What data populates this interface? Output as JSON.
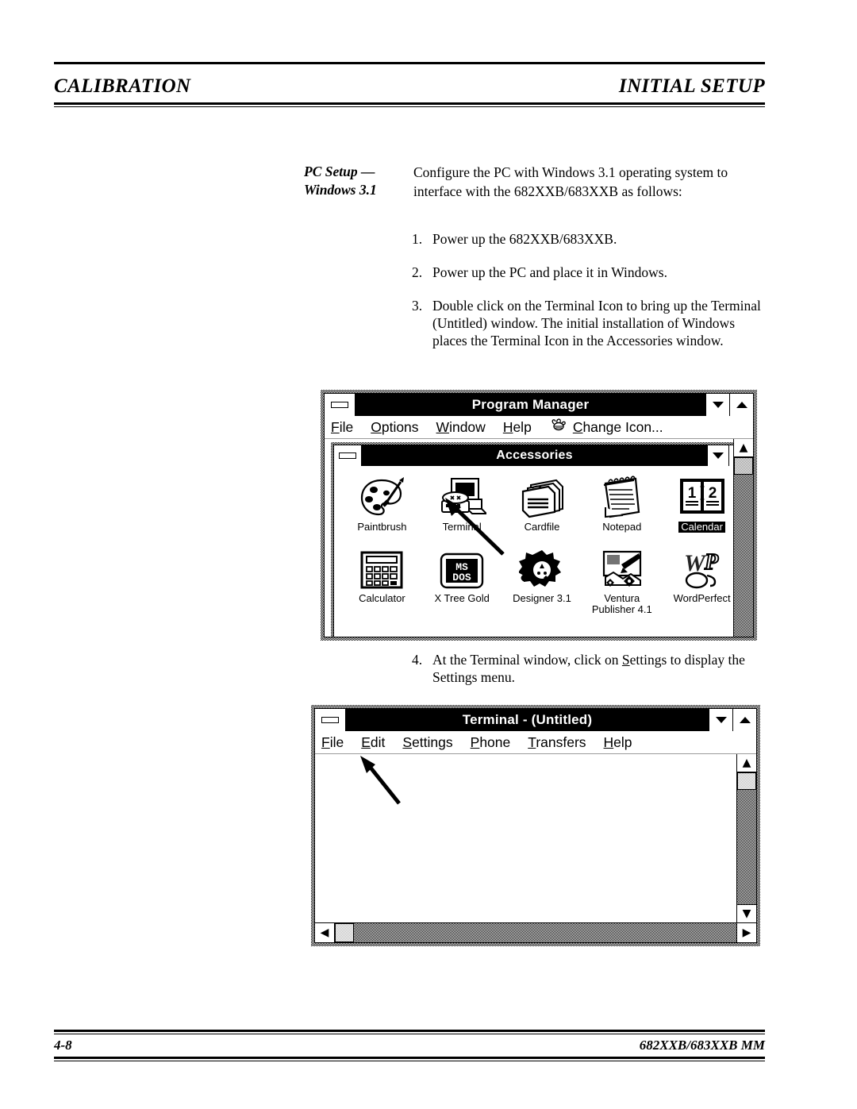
{
  "header": {
    "left": "CALIBRATION",
    "right": "INITIAL SETUP"
  },
  "side_heading": {
    "line1": "PC Setup —",
    "line2": "Windows 3.1"
  },
  "intro": "Configure the PC with Windows 3.1 operating system to interface with the 682XXB/683XXB as follows:",
  "steps": [
    {
      "num": "1.",
      "text": "Power up the 682XXB/683XXB."
    },
    {
      "num": "2.",
      "text": "Power up the PC and place it in Windows."
    },
    {
      "num": "3.",
      "text": "Double click on the Terminal Icon to bring up the Terminal (Untitled) window. The initial installation of Windows places the Terminal Icon in the Accessories window."
    }
  ],
  "step4": {
    "num": "4.",
    "text_before": "At the Terminal window, click on ",
    "accel": "S",
    "text_after": "ettings to display the Settings menu."
  },
  "progman": {
    "title": "Program Manager",
    "menu": [
      {
        "accel": "F",
        "rest": "ile"
      },
      {
        "accel": "O",
        "rest": "ptions"
      },
      {
        "accel": "W",
        "rest": "indow"
      },
      {
        "accel": "H",
        "rest": "elp"
      }
    ],
    "change_icon": {
      "accel": "C",
      "rest": "hange Icon..."
    },
    "minimize_label": "minimize",
    "maximize_label": "maximize",
    "group": {
      "title": "Accessories",
      "rows": [
        [
          {
            "label": "Paintbrush",
            "icon": "paintbrush-icon",
            "selected": false
          },
          {
            "label": "Terminal",
            "icon": "terminal-icon",
            "selected": false
          },
          {
            "label": "Cardfile",
            "icon": "cardfile-icon",
            "selected": false
          },
          {
            "label": "Notepad",
            "icon": "notepad-icon",
            "selected": false
          },
          {
            "label": "Calendar",
            "icon": "calendar-icon",
            "selected": true
          }
        ],
        [
          {
            "label": "Calculator",
            "icon": "calculator-icon",
            "selected": false
          },
          {
            "label": "X Tree Gold",
            "icon": "msdos-icon",
            "selected": false
          },
          {
            "label": "Designer 3.1",
            "icon": "designer-icon",
            "selected": false
          },
          {
            "label": "Ventura",
            "label2": "Publisher 4.1",
            "icon": "ventura-icon",
            "selected": false
          },
          {
            "label": "WordPerfect",
            "icon": "wordperfect-icon",
            "selected": false
          }
        ]
      ]
    }
  },
  "terminal": {
    "title": "Terminal - (Untitled)",
    "menu": [
      {
        "accel": "F",
        "rest": "ile"
      },
      {
        "accel": "E",
        "rest": "dit"
      },
      {
        "accel": "S",
        "rest": "ettings"
      },
      {
        "accel": "P",
        "rest": "hone"
      },
      {
        "accel": "T",
        "rest": "ransfers"
      },
      {
        "accel": "H",
        "rest": "elp"
      }
    ]
  },
  "footer": {
    "left": "4-8",
    "right": "682XXB/683XXB MM"
  }
}
